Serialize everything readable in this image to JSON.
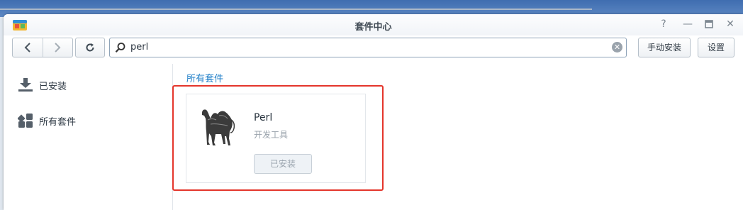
{
  "window": {
    "title": "套件中心"
  },
  "toolbar": {
    "search_value": "perl",
    "manual_install_label": "手动安装",
    "settings_label": "设置"
  },
  "sidebar": {
    "items": [
      {
        "label": "已安装",
        "icon": "download-icon"
      },
      {
        "label": "所有套件",
        "icon": "grid-icon"
      }
    ]
  },
  "main": {
    "section_title": "所有套件",
    "package": {
      "name": "Perl",
      "category": "开发工具",
      "status_button": "已安装",
      "icon": "camel-icon"
    }
  },
  "colors": {
    "accent": "#1e7ec8",
    "highlight": "#e4352b",
    "desktop": "#3f6db0"
  }
}
